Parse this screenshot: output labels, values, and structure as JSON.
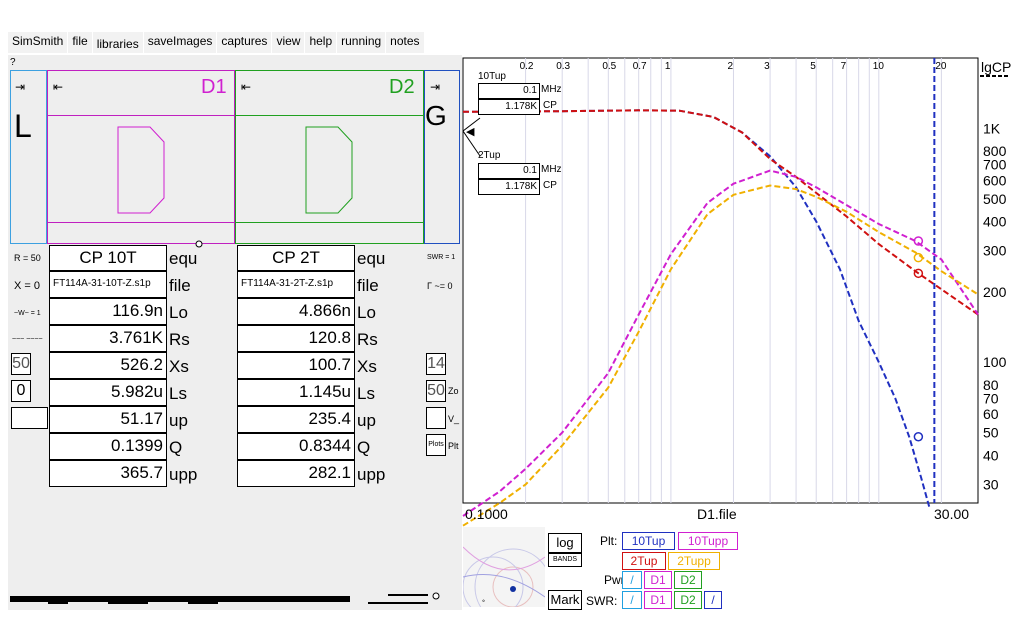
{
  "menu": [
    "SimSmith",
    "file",
    "libraries",
    "saveImages",
    "captures",
    "view",
    "help",
    "running",
    "notes"
  ],
  "question_mark": "?",
  "circuit": {
    "L_label": "L",
    "G_label": "G",
    "D1_label": "D1",
    "D2_label": "D2",
    "arrow": "⇥",
    "back_arrow": "⇤"
  },
  "left_side": {
    "R": "R = 50",
    "X": "X = 0",
    "W": "~W~ = 1",
    "misc": "~~~ ~~~~",
    "box1": "50",
    "box2": "0"
  },
  "right_side": {
    "SWR": "SWR = 1",
    "Gamma": "Γ ~= 0",
    "box1": "14",
    "box2": "50",
    "Zo": "Zo",
    "V": "V_",
    "plots": "Plots",
    "plt": "Plt"
  },
  "table1": {
    "head": "CP 10T",
    "file": "FT114A-31-10T-Z.s1p",
    "values": [
      "116.9n",
      "3.761K",
      "526.2",
      "5.982u",
      "51.17",
      "0.1399",
      "365.7"
    ]
  },
  "table2": {
    "head": "CP 2T",
    "file": "FT114A-31-2T-Z.s1p",
    "values": [
      "4.866n",
      "120.8",
      "100.7",
      "1.145u",
      "235.4",
      "0.8344",
      "282.1"
    ]
  },
  "row_units": [
    "equ",
    "file",
    "Lo",
    "Rs",
    "Xs",
    "Ls",
    "up",
    "Q",
    "upp"
  ],
  "chart": {
    "x_top_ticks": [
      "0.2",
      "0.3",
      "0.5",
      "0.7",
      "1",
      "2",
      "3",
      "5",
      "7",
      "10",
      "20"
    ],
    "y_ticks": [
      "1K",
      "800",
      "700",
      "600",
      "500",
      "400",
      "300",
      "200",
      "100",
      "80",
      "70",
      "60",
      "50",
      "40",
      "30"
    ],
    "y_axis_title": "lgCP",
    "x_min_label": "0.1000",
    "x_max_label": "30.00",
    "x_axis_title": "D1.file",
    "marker1": {
      "name": "10Tup",
      "freq": "0.1",
      "freq_unit": "MHz",
      "value": "1.178K",
      "value_unit": "CP"
    },
    "marker2": {
      "name": "2Tup",
      "freq": "0.1",
      "freq_unit": "MHz",
      "value": "1.178K",
      "value_unit": "CP"
    }
  },
  "controls": {
    "log": "log",
    "bands": "BANDS",
    "mark": "Mark",
    "plt_label": "Plt:",
    "pwr_label": "Pwr:",
    "swr_label": "SWR:",
    "legend": [
      "10Tup",
      "10Tupp",
      "2Tup",
      "2Tupp"
    ],
    "pwr_buttons": [
      "D1",
      "D2"
    ],
    "swr_buttons": [
      "D1",
      "D2"
    ]
  },
  "colors": {
    "10Tup": "#2030c0",
    "10Tupp": "#d020d0",
    "2Tup": "#d01010",
    "2Tupp": "#f0b000"
  }
}
